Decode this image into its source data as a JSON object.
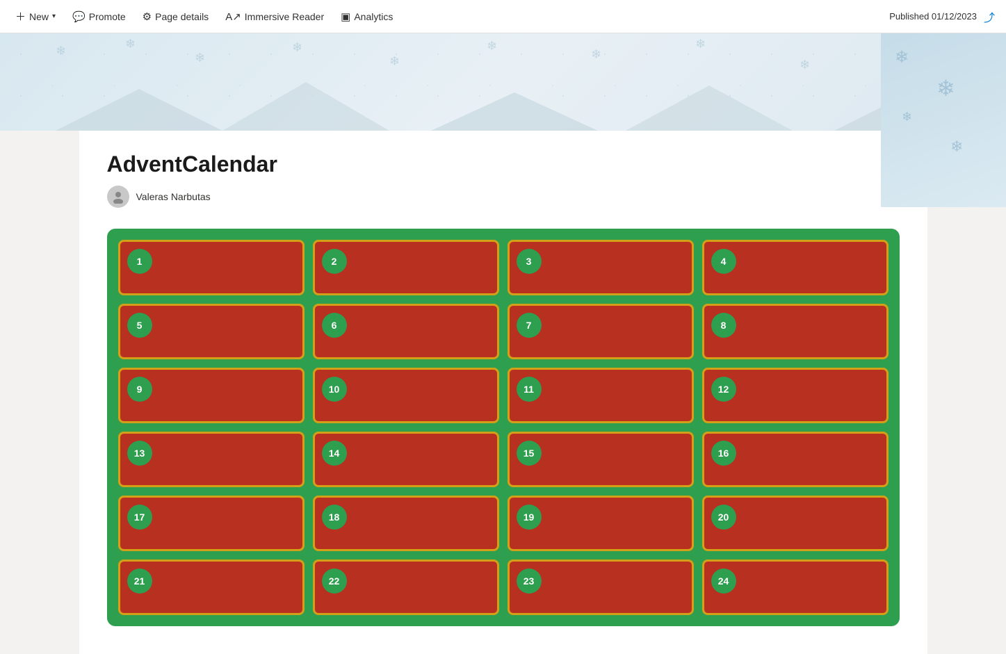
{
  "toolbar": {
    "new_label": "New",
    "new_dropdown": true,
    "promote_label": "Promote",
    "page_details_label": "Page details",
    "immersive_reader_label": "Immersive Reader",
    "analytics_label": "Analytics",
    "published_label": "Published 01/12/2023"
  },
  "page": {
    "title": "AdventCalendar",
    "author": "Valeras Narbutas"
  },
  "calendar": {
    "background_color": "#2e9e4f",
    "cell_color": "#b83020",
    "border_color": "#d4a017",
    "badge_color": "#2e9e4f",
    "days": [
      {
        "number": "1"
      },
      {
        "number": "2"
      },
      {
        "number": "3"
      },
      {
        "number": "4"
      },
      {
        "number": "5"
      },
      {
        "number": "6"
      },
      {
        "number": "7"
      },
      {
        "number": "8"
      },
      {
        "number": "9"
      },
      {
        "number": "10"
      },
      {
        "number": "11"
      },
      {
        "number": "12"
      },
      {
        "number": "13"
      },
      {
        "number": "14"
      },
      {
        "number": "15"
      },
      {
        "number": "16"
      },
      {
        "number": "17"
      },
      {
        "number": "18"
      },
      {
        "number": "19"
      },
      {
        "number": "20"
      },
      {
        "number": "21"
      },
      {
        "number": "22"
      },
      {
        "number": "23"
      },
      {
        "number": "24"
      }
    ]
  }
}
